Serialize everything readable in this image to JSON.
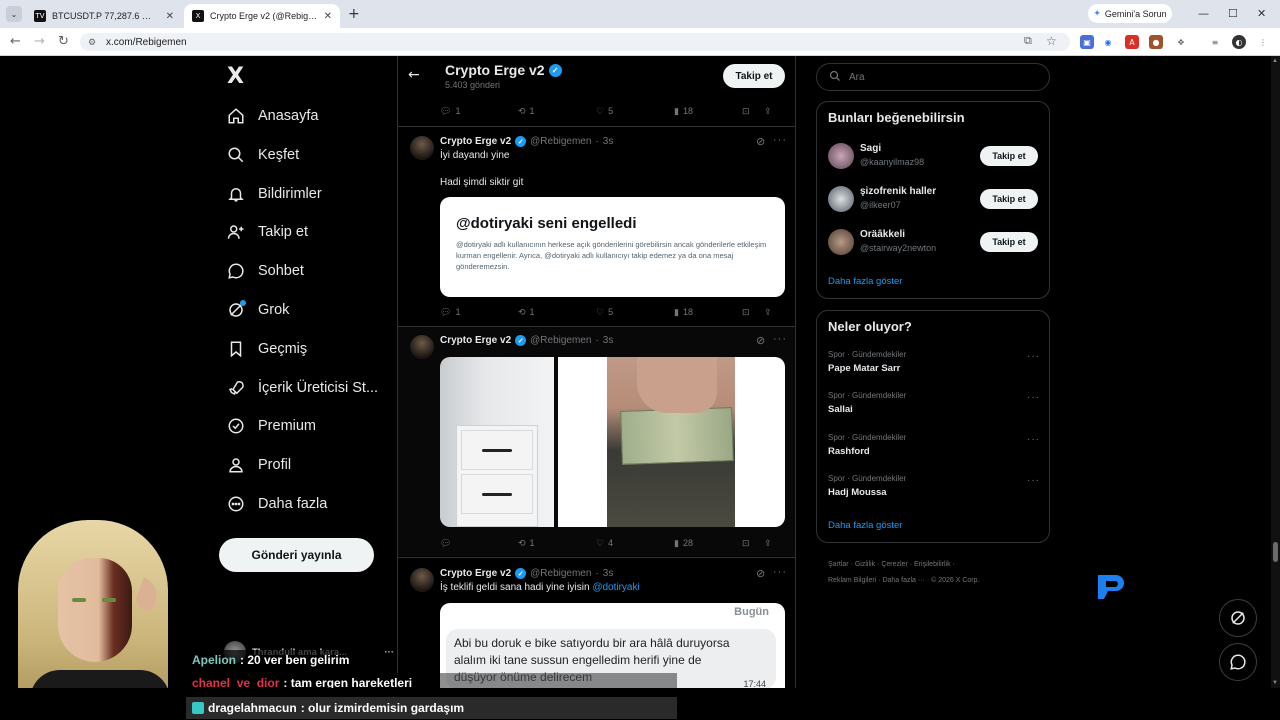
{
  "browser": {
    "tabs": [
      {
        "label": "BTCUSDT.P 77,287.6 ▲ +5.88%",
        "favicon": "TV"
      },
      {
        "label": "Crypto Erge v2 (@Rebigemen)",
        "favicon": "X"
      }
    ],
    "url": "x.com/Rebigemen",
    "gemini_label": "Gemini'a Sorun"
  },
  "nav": {
    "logo": "X",
    "items": [
      "Anasayfa",
      "Keşfet",
      "Bildirimler",
      "Takip et",
      "Sohbet",
      "Grok",
      "Geçmiş",
      "İçerik Üreticisi St...",
      "Premium",
      "Profil",
      "Daha fazla"
    ],
    "post_button": "Gönderi yayınla"
  },
  "profile_header": {
    "name": "Crypto Erge v2",
    "posts_count": "5.403 gönderi",
    "follow_label": "Takip et"
  },
  "tweets": [
    {
      "stats": {
        "replies": "1",
        "retweets": "1",
        "likes": "5",
        "views": "18"
      }
    },
    {
      "name": "Crypto Erge v2",
      "handle": "@Rebigemen",
      "time": "3s",
      "text": "İyi dayandı yine",
      "text2": "Hadi şimdi siktir git",
      "card_title": "@dotiryaki seni engelledi",
      "card_body": "@dotiryaki adlı kullanıcının herkese açık gönderilerini görebilirsin ancak gönderilerle etkileşim kurman engellenir. Ayrıca, @dotiryaki adlı kullanıcıyı takip edemez ya da ona mesaj gönderemezsin.",
      "stats": {
        "replies": "1",
        "retweets": "1",
        "likes": "5",
        "views": "18"
      }
    },
    {
      "name": "Crypto Erge v2",
      "handle": "@Rebigemen",
      "time": "3s",
      "stats": {
        "replies": "",
        "retweets": "1",
        "likes": "4",
        "views": "28"
      }
    },
    {
      "name": "Crypto Erge v2",
      "handle": "@Rebigemen",
      "time": "3s",
      "text": "İş teklifi geldi sana hadi yine iyisin",
      "mention": "@dotiryaki",
      "ss_header": "Bugün",
      "ss_message": "Abi bu doruk e bike satıyordu bir ara hâlâ duruyorsa alalım iki tane sussun engelledim herifi yine de düşüyor önüme delirecem",
      "ss_time": "17:44"
    }
  ],
  "search": {
    "placeholder": "Ara"
  },
  "suggestions": {
    "title": "Bunları beğenebilirsin",
    "users": [
      {
        "name": "Sagi",
        "handle": "@kaanyilmaz98",
        "button": "Takip et"
      },
      {
        "name": "şizofrenik haller",
        "handle": "@ilkeer07",
        "button": "Takip et"
      },
      {
        "name": "Oräâkkeli",
        "handle": "@stairway2newton",
        "button": "Takip et"
      }
    ],
    "show_more": "Daha fazla göster"
  },
  "trends": {
    "title": "Neler oluyor?",
    "items": [
      {
        "category": "Spor · Gündemdekiler",
        "title": "Pape Matar Sarr"
      },
      {
        "category": "Spor · Gündemdekiler",
        "title": "Sallai"
      },
      {
        "category": "Spor · Gündemdekiler",
        "title": "Rashford"
      },
      {
        "category": "Spor · Gündemdekiler",
        "title": "Hadj Moussa"
      }
    ],
    "show_more": "Daha fazla göster"
  },
  "footer": [
    "Şartlar",
    "Gizlilik",
    "Çerezler",
    "Erişilebilirlik",
    "Reklam Bilgileri",
    "Daha fazla ···",
    "© 2026 X Corp."
  ],
  "stream_overlay": {
    "partial_user": "Thranduil ama kara...",
    "chat": [
      {
        "user": "Apelion",
        "message": ": 20 ver ben gelirim",
        "color": "#7ec8c0"
      },
      {
        "user": "chanel_ve_dior",
        "message": ": tam ergen hareketleri",
        "color": "#e2324a"
      },
      {
        "user": "dragelahmacun",
        "message": ": olur izmirdemisin gardaşım",
        "color": "#ffffff"
      }
    ]
  },
  "colors": {
    "accent": "#1d9bf0",
    "background": "#000000",
    "border": "#2f3336"
  }
}
